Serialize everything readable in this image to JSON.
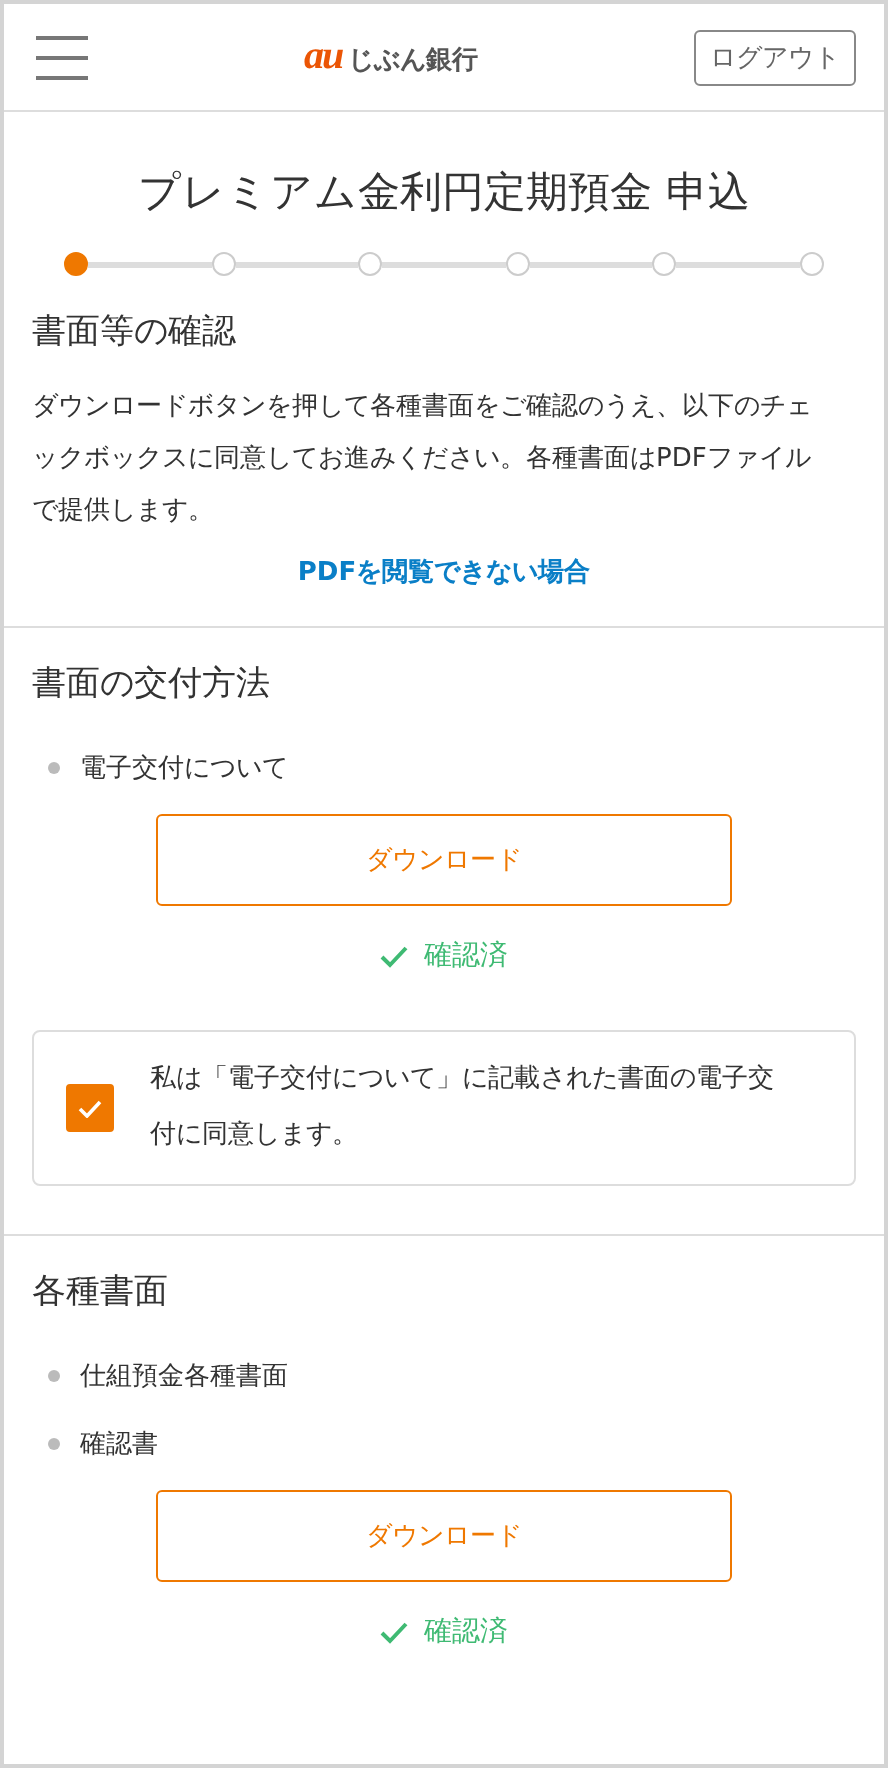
{
  "header": {
    "logo_mark": "au",
    "logo_text": "じぶん銀行",
    "logout_button": "ログアウト"
  },
  "page_title": "プレミアム金利円定期預金 申込",
  "steps": [
    {
      "selected": true
    },
    {
      "selected": false
    },
    {
      "selected": false
    },
    {
      "selected": false
    },
    {
      "selected": false
    },
    {
      "selected": false
    }
  ],
  "sections": [
    {
      "title": "書面等の確認",
      "description": "ダウンロードボタンを押して各種書面をご確認のうえ、以下のチェックボックスに同意してお進みください。各種書面はPDFファイルで提供します。",
      "link": "PDFを閲覧できない場合"
    },
    {
      "title": "書面の交付方法",
      "documents": [
        "電子交付について"
      ],
      "download_button": "ダウンロード",
      "status": "確認済",
      "agreement": {
        "text": "私は「電子交付について」に記載された書面の電子交付に同意します。",
        "checked": true
      }
    },
    {
      "title": "各種書面",
      "documents": [
        "仕組預金各種書面",
        "確認書"
      ],
      "download_button": "ダウンロード",
      "status": "確認済"
    }
  ]
}
